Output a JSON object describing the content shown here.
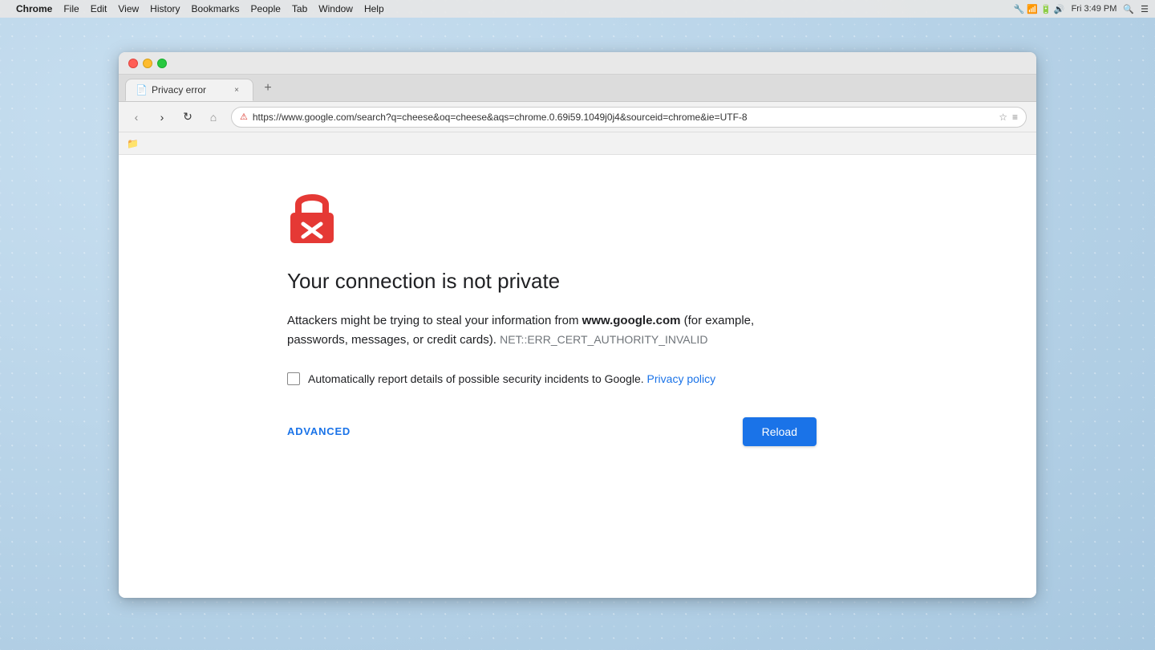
{
  "system": {
    "menu_items": [
      "Chrome",
      "File",
      "Edit",
      "View",
      "History",
      "Bookmarks",
      "People",
      "Tab",
      "Window",
      "Help"
    ],
    "time": "Fri 3:49 PM",
    "apple_symbol": ""
  },
  "browser": {
    "window_title": "Privacy error",
    "tab": {
      "title": "Privacy error",
      "close_label": "×"
    },
    "new_tab_label": "+",
    "nav": {
      "back_label": "‹",
      "forward_label": "›",
      "reload_label": "↻",
      "home_label": "⌂",
      "security_icon": "🔴",
      "url": "https://www.google.com/search?q=cheese&oq=cheese&aqs=chrome.0.69i59.1049j0j4&sourceid=chrome&ie=UTF-8",
      "url_display": "https://www.google.com/search?q=cheese&oq=cheese&aqs=chrome.0.69i59.1049j0j4&sourceid=chrome&ie=UTF-8",
      "star_icon": "☆",
      "reader_icon": "≡"
    }
  },
  "error_page": {
    "title": "Your connection is not private",
    "description_before": "Attackers might be trying to steal your information from",
    "domain": "www.google.com",
    "description_after": "(for example, passwords, messages, or credit cards).",
    "error_code": "NET::ERR_CERT_AUTHORITY_INVALID",
    "checkbox_label": "Automatically report details of possible security incidents to Google.",
    "privacy_policy_link": "Privacy policy",
    "advanced_label": "ADVANCED",
    "reload_label": "Reload"
  }
}
